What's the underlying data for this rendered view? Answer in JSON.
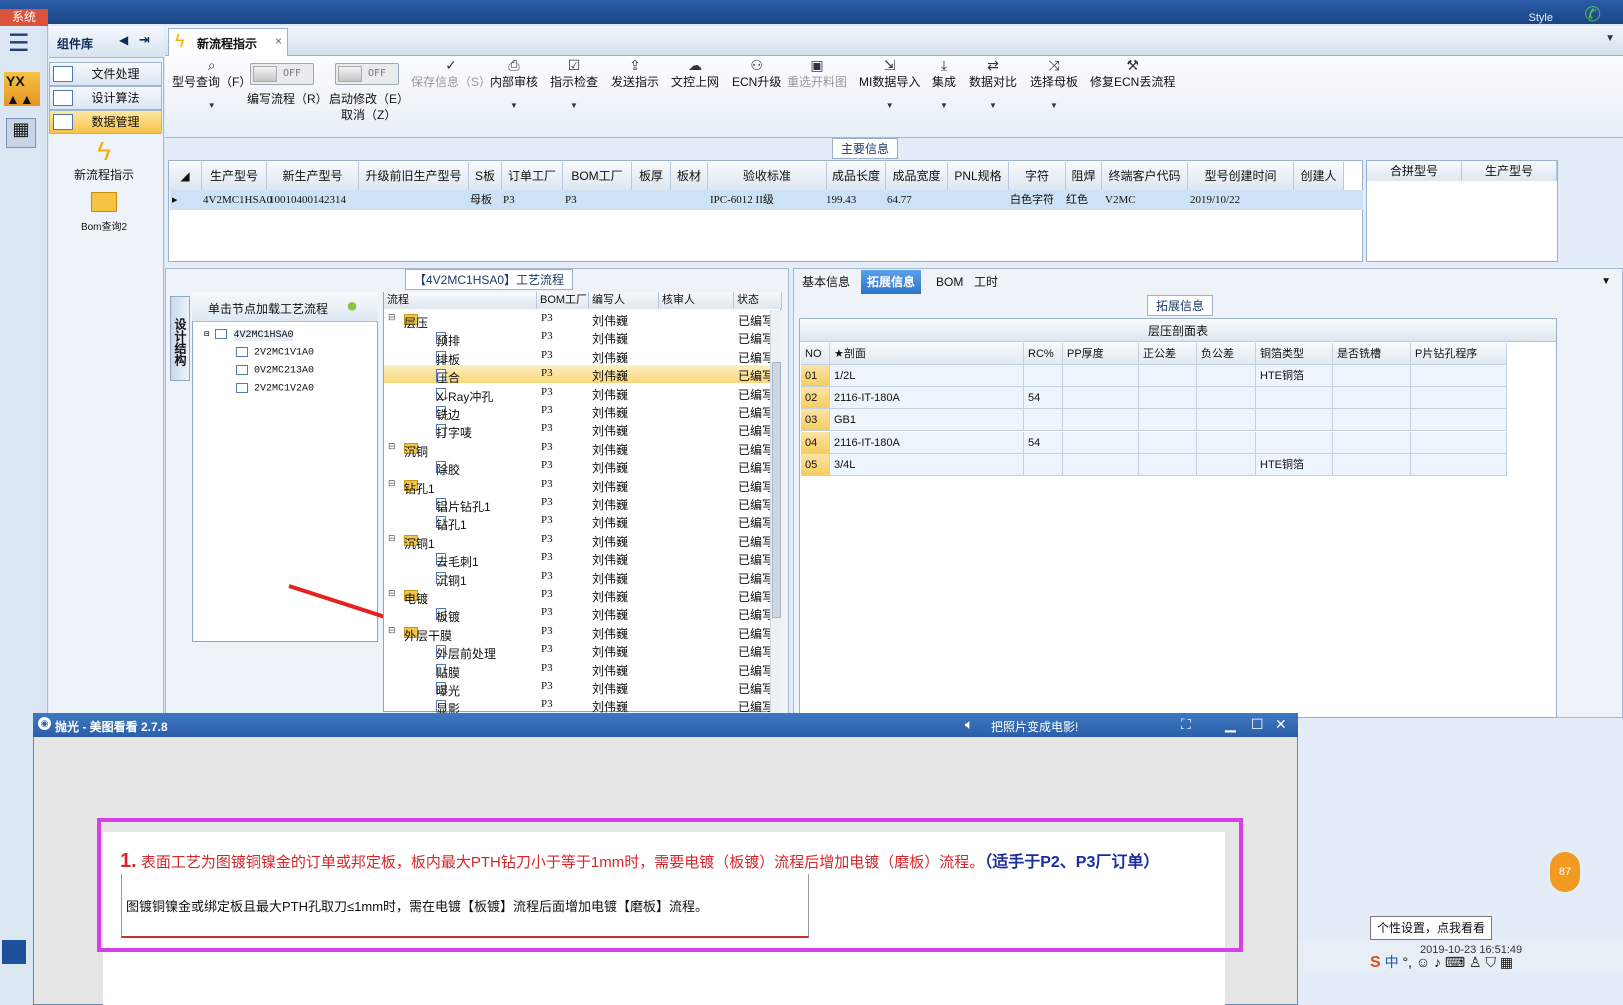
{
  "system": {
    "tab": "系统",
    "style_label": "Style"
  },
  "components": {
    "title": "组件库",
    "items": [
      "文件处理",
      "设计算法",
      "数据管理"
    ],
    "tools": [
      "新流程指示",
      "Bom查询2"
    ]
  },
  "tab": {
    "label": "新流程指示"
  },
  "toolbar": {
    "query": "型号查询（F）",
    "write_flow": "编写流程（R）",
    "start_modify": "启动修改（E）",
    "cancel": "取消（Z）",
    "toggle_off": "OFF",
    "save": "保存信息（S）",
    "internal_review": "内部审核",
    "check": "指示检查",
    "send": "发送指示",
    "upload": "文控上网",
    "ecn": "ECN升级",
    "reselect": "重选开料图",
    "mi_import": "MI数据导入",
    "integrate": "集成",
    "compare": "数据对比",
    "select_mother": "选择母板",
    "fix_ecn": "修复ECN丢流程"
  },
  "main_info": {
    "section_title": "主要信息",
    "headers": [
      "生产型号",
      "新生产型号",
      "升级前旧生产型号",
      "S板",
      "订单工厂",
      "BOM工厂",
      "板厚",
      "板材",
      "验收标准",
      "成品长度",
      "成品宽度",
      "PNL规格",
      "字符",
      "阻焊",
      "终端客户代码",
      "型号创建时间",
      "创建人"
    ],
    "row": [
      "4V2MC1HSA0",
      "10010400142314",
      "",
      "母板",
      "P3",
      "P3",
      "",
      "",
      "IPC-6012 II级",
      "199.43",
      "64.77",
      "",
      "白色字符",
      "红色",
      "V2MC",
      "2019/10/22",
      ""
    ],
    "merge_headers": [
      "合拼型号",
      "生产型号"
    ]
  },
  "process": {
    "title": "【4V2MC1HSA0】工艺流程",
    "side_tab": "设计结构",
    "tree_hint": "单击节点加载工艺流程",
    "tree": [
      "4V2MC1HSA0",
      "2V2MC1V1A0",
      "0V2MC213A0",
      "2V2MC1V2A0"
    ],
    "headers": [
      "流程",
      "BOM工厂",
      "编写人",
      "核审人",
      "状态"
    ],
    "rows": [
      {
        "name": "层压",
        "type": "folder",
        "level": 0,
        "bom": "P3",
        "writer": "刘伟巍",
        "status": "已编写"
      },
      {
        "name": "预排",
        "type": "doc",
        "level": 1,
        "bom": "P3",
        "writer": "刘伟巍",
        "status": "已编写"
      },
      {
        "name": "排板",
        "type": "doc",
        "level": 1,
        "bom": "P3",
        "writer": "刘伟巍",
        "status": "已编写"
      },
      {
        "name": "压合",
        "type": "doc",
        "level": 1,
        "bom": "P3",
        "writer": "刘伟巍",
        "status": "已编写"
      },
      {
        "name": "X-Ray冲孔",
        "type": "doc",
        "level": 1,
        "bom": "P3",
        "writer": "刘伟巍",
        "status": "已编写"
      },
      {
        "name": "铣边",
        "type": "doc",
        "level": 1,
        "bom": "P3",
        "writer": "刘伟巍",
        "status": "已编写"
      },
      {
        "name": "打字唛",
        "type": "doc",
        "level": 1,
        "bom": "P3",
        "writer": "刘伟巍",
        "status": "已编写"
      },
      {
        "name": "沉铜",
        "type": "folder",
        "level": 0,
        "bom": "P3",
        "writer": "刘伟巍",
        "status": "已编写"
      },
      {
        "name": "除胶",
        "type": "doc",
        "level": 1,
        "bom": "P3",
        "writer": "刘伟巍",
        "status": "已编写"
      },
      {
        "name": "钻孔1",
        "type": "folder",
        "level": 0,
        "bom": "P3",
        "writer": "刘伟巍",
        "status": "已编写"
      },
      {
        "name": "铝片钻孔1",
        "type": "doc",
        "level": 1,
        "bom": "P3",
        "writer": "刘伟巍",
        "status": "已编写"
      },
      {
        "name": "钻孔1",
        "type": "doc",
        "level": 1,
        "bom": "P3",
        "writer": "刘伟巍",
        "status": "已编写"
      },
      {
        "name": "沉铜1",
        "type": "folder",
        "level": 0,
        "bom": "P3",
        "writer": "刘伟巍",
        "status": "已编写"
      },
      {
        "name": "去毛刺1",
        "type": "doc",
        "level": 1,
        "bom": "P3",
        "writer": "刘伟巍",
        "status": "已编写"
      },
      {
        "name": "沉铜1",
        "type": "doc",
        "level": 1,
        "bom": "P3",
        "writer": "刘伟巍",
        "status": "已编写"
      },
      {
        "name": "电镀",
        "type": "folder",
        "level": 0,
        "bom": "P3",
        "writer": "刘伟巍",
        "status": "已编写"
      },
      {
        "name": "板镀",
        "type": "doc",
        "level": 1,
        "bom": "P3",
        "writer": "刘伟巍",
        "status": "已编写"
      },
      {
        "name": "外层干膜",
        "type": "folder",
        "level": 0,
        "bom": "P3",
        "writer": "刘伟巍",
        "status": "已编写"
      },
      {
        "name": "外层前处理",
        "type": "doc",
        "level": 1,
        "bom": "P3",
        "writer": "刘伟巍",
        "status": "已编写"
      },
      {
        "name": "贴膜",
        "type": "doc",
        "level": 1,
        "bom": "P3",
        "writer": "刘伟巍",
        "status": "已编写"
      },
      {
        "name": "曝光",
        "type": "doc",
        "level": 1,
        "bom": "P3",
        "writer": "刘伟巍",
        "status": "已编写"
      },
      {
        "name": "显影",
        "type": "doc",
        "level": 1,
        "bom": "P3",
        "writer": "刘伟巍",
        "status": "已编写"
      }
    ],
    "selected_index": 3
  },
  "right_tabs": [
    "基本信息",
    "拓展信息",
    "BOM",
    "工时"
  ],
  "extended": {
    "section_title": "拓展信息",
    "table_title": "层压剖面表",
    "headers": [
      "NO",
      "★剖面",
      "RC%",
      "PP厚度",
      "正公差",
      "负公差",
      "铜箔类型",
      "是否铣槽",
      "P片钻孔程序"
    ],
    "rows": [
      [
        "01",
        "1/2L",
        "",
        "",
        "",
        "",
        "HTE铜箔",
        "",
        ""
      ],
      [
        "02",
        "2116-IT-180A",
        "54",
        "",
        "",
        "",
        "",
        "",
        ""
      ],
      [
        "03",
        "GB1",
        "",
        "",
        "",
        "",
        "",
        "",
        ""
      ],
      [
        "04",
        "2116-IT-180A",
        "54",
        "",
        "",
        "",
        "",
        "",
        ""
      ],
      [
        "05",
        "3/4L",
        "",
        "",
        "",
        "",
        "HTE铜箔",
        "",
        ""
      ]
    ]
  },
  "viewer": {
    "title": "抛光 - 美图看看 2.7.8",
    "movie_text": "把照片变成电影!",
    "note_number": "1.",
    "note_text": "表面工艺为图镀铜镍金的订单或邦定板，板内最大PTH钻刀小于等于1mm时，需要电镀（板镀）流程后增加电镀（磨板）流程。",
    "note_scope": "（适手于P2、P3厂订单）",
    "note_sub": "图镀铜镍金或绑定板且最大PTH孔取刀≤1mm时，需在电镀【板镀】流程后面增加电镀【磨板】流程。"
  },
  "tray": {
    "tooltip": "个性设置，点我看看",
    "clock": "2019-10-23 16:51:49",
    "badge": "87"
  },
  "colors": {
    "selected_row": "#cde2f7",
    "highlight": "#f8d67c",
    "magenta_frame": "#d83fe6",
    "red_note": "#d6262b",
    "blue_note": "#1a2c9e"
  }
}
